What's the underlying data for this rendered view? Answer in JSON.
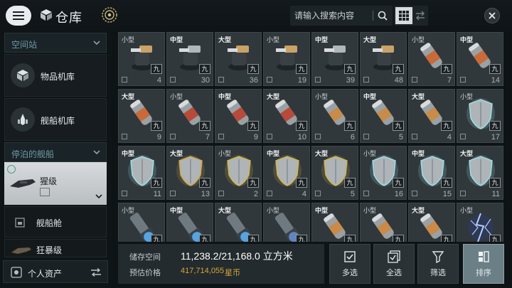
{
  "header": {
    "title": "仓库",
    "search_placeholder": "请输入搜索内容",
    "icons": [
      "menu-icon",
      "warehouse-cube-icon",
      "settings-gear-icon",
      "search-icon",
      "grid-view-icon",
      "swap-icon",
      "close-icon"
    ]
  },
  "sidebar": {
    "section1": {
      "label": "空间站"
    },
    "items": [
      {
        "label": "物品机库",
        "icon": "cube-icon"
      },
      {
        "label": "舰船机库",
        "icon": "ship-icon"
      }
    ],
    "section2": {
      "label": "停泊的舰船"
    },
    "selected_ship": {
      "label": "猩级"
    },
    "sub_items": [
      {
        "label": "舰船舱"
      },
      {
        "label": "狂暴级"
      }
    ],
    "personal": {
      "label": "个人资产"
    }
  },
  "rank_label": "九",
  "grid": {
    "items": [
      {
        "size": "小型",
        "count": "4",
        "art": "turret",
        "accent": "#c9a268"
      },
      {
        "size": "中型",
        "count": "30",
        "art": "turret",
        "accent": "#b0b6b9"
      },
      {
        "size": "大型",
        "count": "36",
        "art": "turret",
        "accent": "#c9a268"
      },
      {
        "size": "小型",
        "count": "19",
        "art": "turret",
        "accent": "#c9a268"
      },
      {
        "size": "中型",
        "count": "39",
        "art": "turret",
        "accent": "#b0b6b9"
      },
      {
        "size": "大型",
        "count": "48",
        "art": "turret",
        "accent": "#c9a268"
      },
      {
        "size": "小型",
        "count": "7",
        "art": "canister",
        "accent": "#c96a3a"
      },
      {
        "size": "中型",
        "count": "14",
        "art": "canister",
        "accent": "#c96a3a"
      },
      {
        "size": "大型",
        "count": "9",
        "art": "canister",
        "accent": "#c96a3a"
      },
      {
        "size": "小型",
        "count": "7",
        "art": "canister",
        "accent": "#b84a3a"
      },
      {
        "size": "中型",
        "count": "9",
        "art": "canister",
        "accent": "#b84a3a"
      },
      {
        "size": "大型",
        "count": "10",
        "art": "canister",
        "accent": "#b84a3a"
      },
      {
        "size": "小型",
        "count": "6",
        "art": "canister",
        "accent": "#c78b4a"
      },
      {
        "size": "中型",
        "count": "5",
        "art": "canister",
        "accent": "#c78b4a"
      },
      {
        "size": "大型",
        "count": "4",
        "art": "canister",
        "accent": "#c78b4a"
      },
      {
        "size": "小型",
        "count": "17",
        "art": "shield",
        "accent": "#9fe3e8"
      },
      {
        "size": "中型",
        "count": "11",
        "art": "shield",
        "accent": "#9fe3e8"
      },
      {
        "size": "大型",
        "count": "13",
        "art": "shield",
        "accent": "#d6a640"
      },
      {
        "size": "小型",
        "count": "2",
        "art": "shield",
        "accent": "#d6b64a"
      },
      {
        "size": "中型",
        "count": "4",
        "art": "shield",
        "accent": "#d6b64a"
      },
      {
        "size": "大型",
        "count": "5",
        "art": "shield",
        "accent": "#d6b64a"
      },
      {
        "size": "小型",
        "count": "16",
        "art": "shield",
        "accent": "#9fe3e8"
      },
      {
        "size": "中型",
        "count": "15",
        "art": "shield",
        "accent": "#9fe3e8"
      },
      {
        "size": "大型",
        "count": "11",
        "art": "shield",
        "accent": "#9fe3e8"
      },
      {
        "size": "小型",
        "count": "",
        "art": "cannon",
        "accent": "#5ab6ff"
      },
      {
        "size": "中型",
        "count": "",
        "art": "cannon",
        "accent": "#5ab6ff"
      },
      {
        "size": "大型",
        "count": "",
        "art": "cannon",
        "accent": "#5ab6ff"
      },
      {
        "size": "小型",
        "count": "",
        "art": "cannon",
        "accent": "#6a8fd8"
      },
      {
        "size": "中型",
        "count": "",
        "art": "canister",
        "accent": "#c98a4a"
      },
      {
        "size": "小型",
        "count": "",
        "art": "canister",
        "accent": "#c98a4a"
      },
      {
        "size": "大型",
        "count": "",
        "art": "canister",
        "accent": "#c98a4a"
      },
      {
        "size": "小型",
        "count": "",
        "art": "lightning",
        "accent": "#b9ccff"
      }
    ]
  },
  "storage": {
    "space_label": "储存空间",
    "space_value": "11,238.2/21,168.0 立方米",
    "price_label": "预估价格",
    "price_value": "417,714,055",
    "price_unit": "星币"
  },
  "actions": [
    {
      "label": "多选",
      "icon": "multi-select-icon"
    },
    {
      "label": "全选",
      "icon": "select-all-icon"
    },
    {
      "label": "筛选",
      "icon": "filter-icon"
    },
    {
      "label": "排序",
      "icon": "sort-icon",
      "active": true
    }
  ]
}
